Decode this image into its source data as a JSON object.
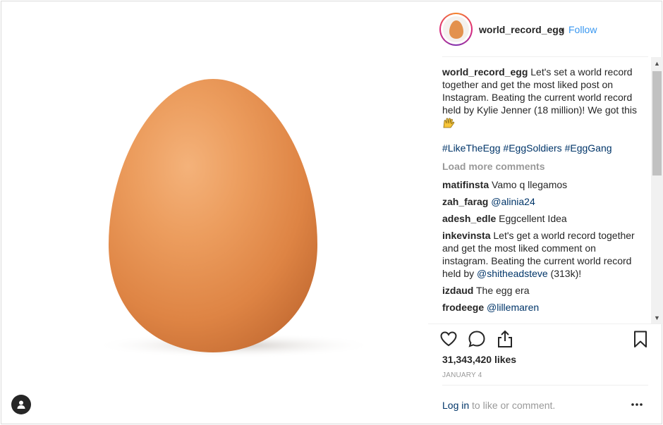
{
  "post": {
    "username": "world_record_egg",
    "follow_label": "Follow",
    "separator": "•",
    "caption_text": "Let's set a world record together and get the most liked post on Instagram. Beating the current world record held by Kylie Jenner (18 million)! We got this",
    "hashtags": [
      "#LikeTheEgg",
      "#EggSoldiers",
      "#EggGang"
    ],
    "load_more_label": "Load more comments",
    "likes": "31,343,420 likes",
    "date": "JANUARY 4",
    "login_link": "Log in",
    "login_rest": " to like or comment."
  },
  "comments": [
    {
      "user": "matifinsta",
      "text": "Vamo q llegamos"
    },
    {
      "user": "zah_farag",
      "mention": "@alinia24"
    },
    {
      "user": "adesh_edle",
      "text": "Eggcellent Idea"
    },
    {
      "user": "inkevinsta",
      "text": "Let's get a world record together and get the most liked comment on instagram. Beating the current world record held by",
      "mention": "@shitheadsteve",
      "suffix": "(313k)!"
    },
    {
      "user": "izdaud",
      "text": "The egg era"
    },
    {
      "user": "frodeege",
      "mention": "@lillemaren"
    }
  ],
  "icons": {
    "user_tag": "person-icon",
    "like": "heart-icon",
    "comment": "speech-bubble-icon",
    "share": "share-icon",
    "save": "bookmark-icon",
    "more": "more-dots-icon"
  },
  "colors": {
    "link_blue": "#3897f0",
    "hashtag_blue": "#003569",
    "muted": "#999999",
    "egg": "#e8924f"
  }
}
